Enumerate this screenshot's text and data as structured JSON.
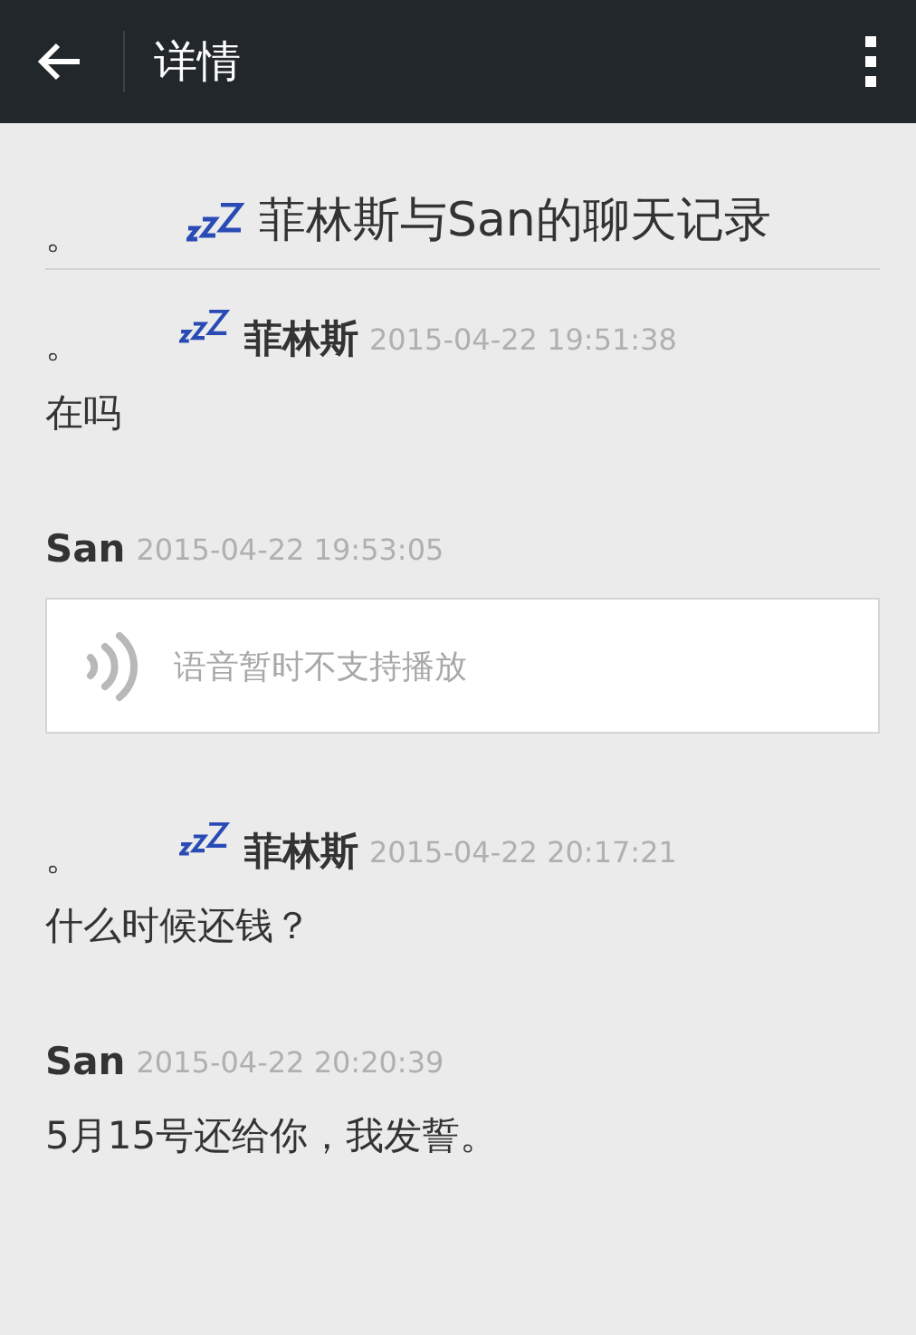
{
  "app_bar": {
    "title": "详情"
  },
  "header": {
    "prefix": "。",
    "sleep_icon": true,
    "title": "菲林斯与San的聊天记录"
  },
  "messages": [
    {
      "kind": "text",
      "prefix": "。",
      "sleep_icon": true,
      "sender": "菲林斯",
      "time": "2015-04-22 19:51:38",
      "text": "在吗"
    },
    {
      "kind": "voice",
      "sleep_icon": false,
      "sender": "San",
      "time": "2015-04-22 19:53:05",
      "text": "语音暂时不支持播放"
    },
    {
      "kind": "text",
      "prefix": "。",
      "sleep_icon": true,
      "sender": "菲林斯",
      "time": "2015-04-22 20:17:21",
      "text": "什么时候还钱？"
    },
    {
      "kind": "text",
      "sleep_icon": false,
      "sender": "San",
      "time": "2015-04-22 20:20:39",
      "text": "5月15号还给你，我发誓。"
    }
  ]
}
